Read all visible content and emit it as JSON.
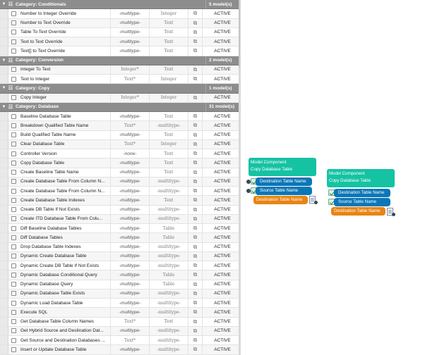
{
  "list": {
    "categories": [
      {
        "name": "Category: Conditionals",
        "count": "5 model(s)",
        "rows": [
          {
            "name": "Number to Integer Override",
            "input": "-multitype-",
            "output": "Integer",
            "status": "ACTIVE"
          },
          {
            "name": "Number to Text Override",
            "input": "-multitype-",
            "output": "Text",
            "status": "ACTIVE"
          },
          {
            "name": "Table To Text Override",
            "input": "-multitype-",
            "output": "Text",
            "status": "ACTIVE"
          },
          {
            "name": "Text to Text Override",
            "input": "-multitype-",
            "output": "Text",
            "status": "ACTIVE"
          },
          {
            "name": "Text[] to Text Override",
            "input": "-multitype-",
            "output": "Text",
            "status": "ACTIVE"
          }
        ]
      },
      {
        "name": "Category: Conversion",
        "count": "2 model(s)",
        "rows": [
          {
            "name": "Integer To Text",
            "input": "Integer*",
            "output": "Text",
            "status": "ACTIVE"
          },
          {
            "name": "Text to Integer",
            "input": "Text*",
            "output": "Integer",
            "status": "ACTIVE"
          }
        ]
      },
      {
        "name": "Category: Copy",
        "count": "1 model(s)",
        "rows": [
          {
            "name": "Copy Integer",
            "input": "Integer*",
            "output": "Integer",
            "status": "ACTIVE"
          }
        ]
      },
      {
        "name": "Category: Database",
        "count": "31 model(s)",
        "rows": [
          {
            "name": "Baseline Database Table",
            "input": "-multitype-",
            "output": "Text",
            "status": "ACTIVE"
          },
          {
            "name": "Breakdown Qualified Table Name",
            "input": "Text*",
            "output": "-multitype-",
            "status": "ACTIVE"
          },
          {
            "name": "Build Qualified Table Name",
            "input": "-multitype-",
            "output": "Text",
            "status": "ACTIVE"
          },
          {
            "name": "Clear Database Table",
            "input": "Text*",
            "output": "Integer",
            "status": "ACTIVE"
          },
          {
            "name": "Controller Version",
            "input": "-none-",
            "output": "Text",
            "status": "ACTIVE"
          },
          {
            "name": "Copy Database Table",
            "input": "-multitype-",
            "output": "Text",
            "status": "ACTIVE"
          },
          {
            "name": "Create Baseline Table Name",
            "input": "-multitype-",
            "output": "Text",
            "status": "ACTIVE"
          },
          {
            "name": "Create Database Table From Column N...",
            "input": "-multitype-",
            "output": "-multitype-",
            "status": "ACTIVE"
          },
          {
            "name": "Create Database Table From Column N...",
            "input": "-multitype-",
            "output": "-multitype-",
            "status": "ACTIVE"
          },
          {
            "name": "Create Database Table Indexes",
            "input": "-multitype-",
            "output": "Text",
            "status": "ACTIVE"
          },
          {
            "name": "Create DB Table If Not Exists",
            "input": "-multitype-",
            "output": "-multitype-",
            "status": "ACTIVE"
          },
          {
            "name": "Create ITD Database Table From Colu...",
            "input": "-multitype-",
            "output": "-multitype-",
            "status": "ACTIVE"
          },
          {
            "name": "Diff Baseline Database Tables",
            "input": "-multitype-",
            "output": "Table",
            "status": "ACTIVE"
          },
          {
            "name": "Diff Database Tables",
            "input": "-multitype-",
            "output": "Table",
            "status": "ACTIVE"
          },
          {
            "name": "Drop Database Table Indexes",
            "input": "-multitype-",
            "output": "-multitype-",
            "status": "ACTIVE"
          },
          {
            "name": "Dynamic Create Database Table",
            "input": "-multitype-",
            "output": "-multitype-",
            "status": "ACTIVE"
          },
          {
            "name": "Dynamic Create DB Table If Not Exists",
            "input": "-multitype-",
            "output": "-multitype-",
            "status": "ACTIVE"
          },
          {
            "name": "Dynamic Database Conditional Query",
            "input": "-multitype-",
            "output": "Table",
            "status": "ACTIVE"
          },
          {
            "name": "Dynamic Database Query",
            "input": "-multitype-",
            "output": "Table",
            "status": "ACTIVE"
          },
          {
            "name": "Dynamic Database Table Exists",
            "input": "-multitype-",
            "output": "-multitype-",
            "status": "ACTIVE"
          },
          {
            "name": "Dynamic Load Database Table",
            "input": "-multitype-",
            "output": "-multitype-",
            "status": "ACTIVE"
          },
          {
            "name": "Execute SQL",
            "input": "-multitype-",
            "output": "-multitype-",
            "status": "ACTIVE"
          },
          {
            "name": "Get Database Table Column Names",
            "input": "Text*",
            "output": "Text",
            "status": "ACTIVE"
          },
          {
            "name": "Get Hybrid Source and Destination Dat...",
            "input": "-multitype-",
            "output": "-multitype-",
            "status": "ACTIVE"
          },
          {
            "name": "Get Source and Destination Databases ...",
            "input": "Text*",
            "output": "-multitype-",
            "status": "ACTIVE"
          },
          {
            "name": "Insert or Update Database Table",
            "input": "-multitype-",
            "output": "-multitype-",
            "status": "ACTIVE"
          }
        ]
      }
    ]
  },
  "canvas": {
    "nodes": [
      {
        "title": "Model Component",
        "subtitle": "Copy Database Table",
        "inputs": [
          "Destination Table Name",
          "Source Table Name"
        ],
        "output": "Destination Table Name"
      },
      {
        "title": "Model Component",
        "subtitle": "Copy Database Table",
        "inputs": [
          "Destination Table Name",
          "Source Table Name"
        ],
        "output": "Destination Table Name"
      }
    ]
  },
  "colors": {
    "category_bg": "#8d8d8d",
    "node_header": "#15c3a3",
    "input_port": "#0b77b7",
    "output_port": "#e88413"
  }
}
